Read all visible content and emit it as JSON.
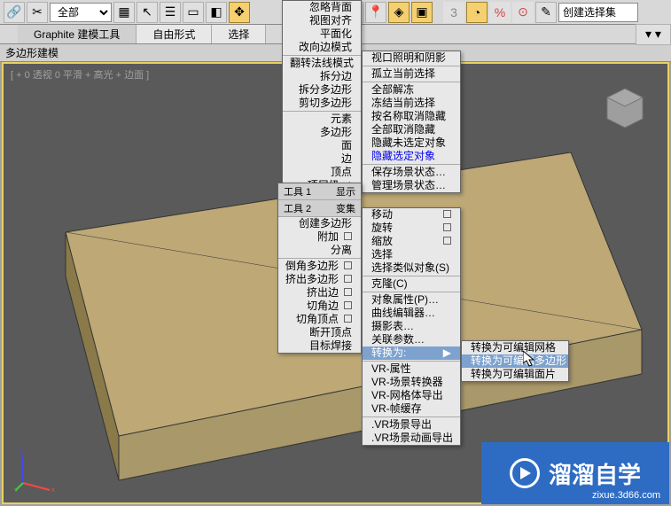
{
  "toolbar": {
    "filter_dropdown": "全部",
    "create_set": "创建选择集"
  },
  "ribbon": {
    "tab1": "Graphite 建模工具",
    "tab2": "自由形式",
    "tab3": "选择"
  },
  "subbar": {
    "label": "多边形建模"
  },
  "viewport": {
    "label": "[ + 0 透视 0 平滑 + 高光 + 边面 ]"
  },
  "menu1": {
    "items": [
      "忽略背面",
      "视图对齐",
      "平面化",
      "改向边模式",
      "翻转法线模式",
      "拆分边",
      "拆分多边形",
      "剪切多边形",
      "元素",
      "多边形",
      "面",
      "边",
      "顶点",
      "项层级"
    ]
  },
  "menu2": {
    "items": [
      "视口照明和阴影",
      "孤立当前选择",
      "全部解冻",
      "冻结当前选择",
      "按名称取消隐藏",
      "全部取消隐藏",
      "隐藏未选定对象",
      "隐藏选定对象",
      "保存场景状态…",
      "管理场景状态…"
    ]
  },
  "menu3": {
    "header_l": "工具 1",
    "header_r": "显示",
    "header2_l": "工具 2",
    "header2_r": "变集",
    "items": [
      "创建多边形",
      "附加",
      "分离",
      "倒角多边形",
      "挤出多边形",
      "挤出边",
      "切角边",
      "切角顶点",
      "断开顶点",
      "目标焊接"
    ]
  },
  "menu4": {
    "items": [
      "移动",
      "旋转",
      "缩放",
      "选择",
      "选择类似对象(S)",
      "克隆(C)",
      "对象属性(P)…",
      "曲线编辑器…",
      "摄影表…",
      "关联参数…",
      "转换为:",
      "VR-属性",
      "VR-场景转换器",
      "VR-网格体导出",
      "VR-帧缓存",
      ".VR场景导出",
      ".VR场景动画导出"
    ]
  },
  "menu5": {
    "items": [
      "转换为可编辑网格",
      "转换为可编辑多边形",
      "转换为可编辑面片"
    ]
  },
  "watermark": {
    "brand": "溜溜自学",
    "url": "zixue.3d66.com"
  },
  "chart_data": null
}
